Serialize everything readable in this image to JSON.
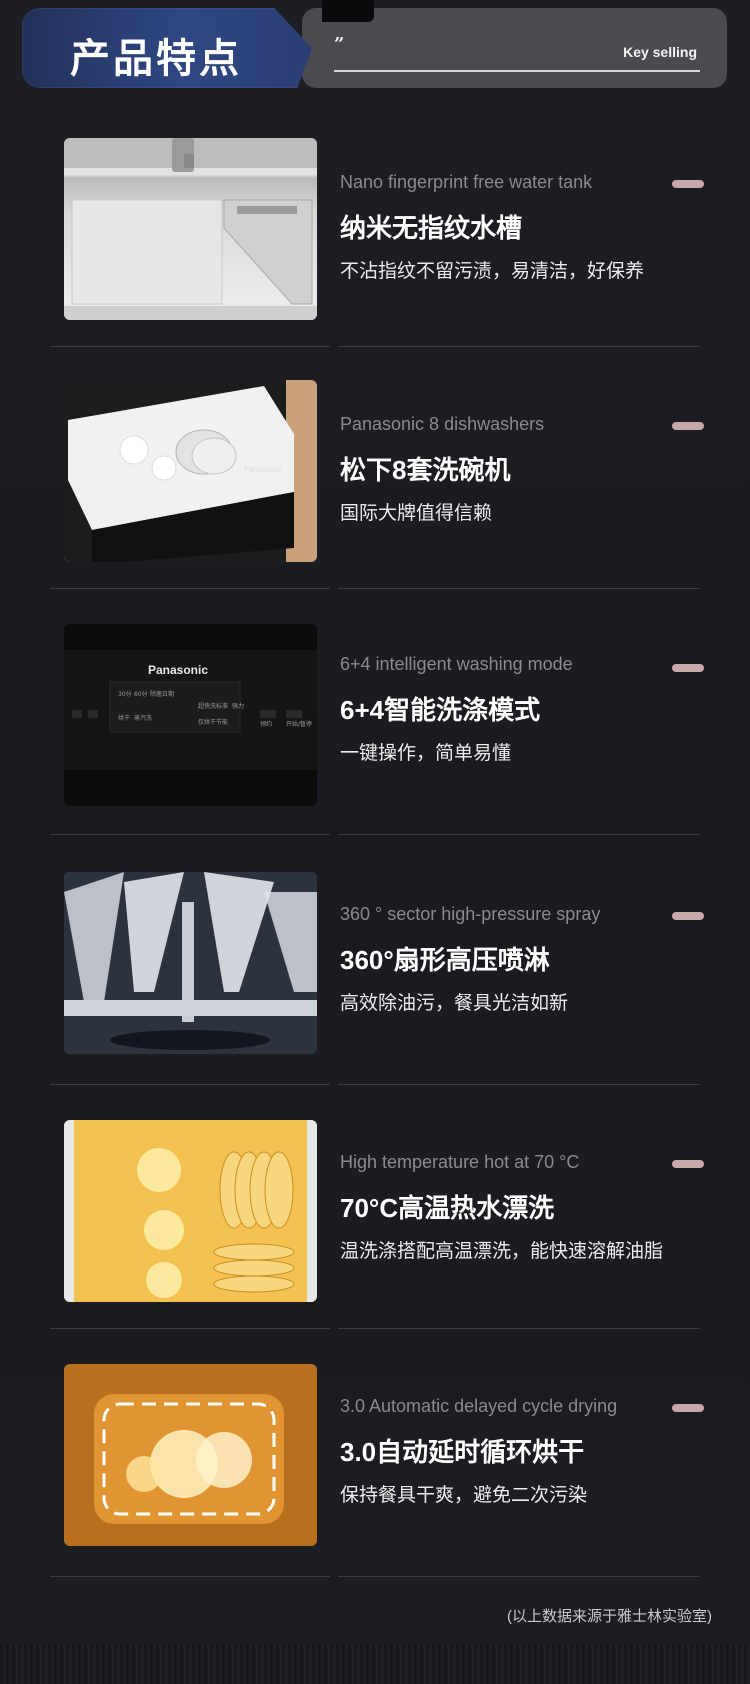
{
  "header": {
    "title": "产品特点",
    "quote_mark": "”",
    "key_selling": "Key selling"
  },
  "features": [
    {
      "en": "Nano fingerprint free water tank",
      "cn": "纳米无指纹水槽",
      "desc": "不沾指纹不留污渍，易清洁，好保养",
      "image": "sink-photo"
    },
    {
      "en": "Panasonic 8 dishwashers",
      "cn": "松下8套洗碗机",
      "desc": "国际大牌值得信赖",
      "image": "dishwasher-open-photo",
      "brand": "Panasonic"
    },
    {
      "en": "6+4 intelligent washing mode",
      "cn": "6+4智能洗涤模式",
      "desc": "一键操作，简单易懂",
      "image": "control-panel-photo",
      "brand": "Panasonic",
      "panel_labels": [
        "30分",
        "60分",
        "除菌日期",
        "超快洗",
        "标准",
        "强力",
        "烘干",
        "仅烘干",
        "蒸汽洗",
        "节能",
        "开始/暂停",
        "预约"
      ]
    },
    {
      "en": "360 ° sector high-pressure spray",
      "cn": "360°扇形高压喷淋",
      "desc": "高效除油污，餐具光洁如新",
      "image": "spray-photo"
    },
    {
      "en": "High temperature hot  at 70 °C",
      "cn": "70°C高温热水漂洗",
      "desc": "温洗涤搭配高温漂洗，能快速溶解油脂",
      "image": "hot-rinse-photo"
    },
    {
      "en": "3.0 Automatic delayed cycle drying",
      "cn": "3.0自动延时循环烘干",
      "desc": "保持餐具干爽，避免二次污染",
      "image": "drying-photo"
    }
  ],
  "footnote": "(以上数据来源于雅士林实验室)",
  "colors": {
    "background": "#1b1c21",
    "header_blue": "#2e4783",
    "pill": "#c7a8ab",
    "en_text": "#8a8b90"
  }
}
